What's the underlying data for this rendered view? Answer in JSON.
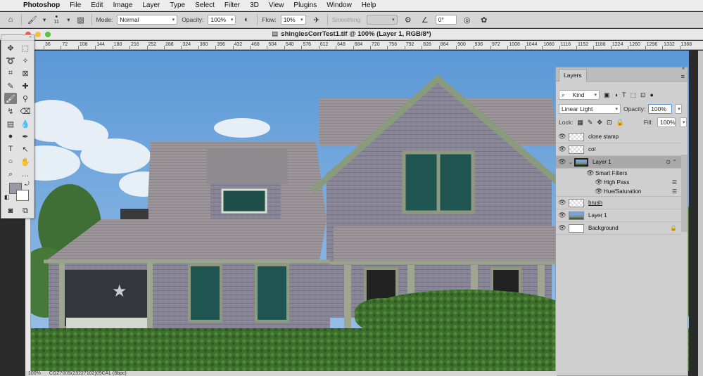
{
  "menubar": {
    "apple_icon": "apple-icon",
    "items": [
      "Photoshop",
      "File",
      "Edit",
      "Image",
      "Layer",
      "Type",
      "Select",
      "Filter",
      "3D",
      "View",
      "Plugins",
      "Window",
      "Help"
    ]
  },
  "options": {
    "brush_size": "11",
    "mode_label": "Mode:",
    "mode_value": "Normal",
    "opacity_label": "Opacity:",
    "opacity_value": "100%",
    "flow_label": "Flow:",
    "flow_value": "10%",
    "smoothing_label": "Smoothing:",
    "smoothing_value": "",
    "angle_value": "0°"
  },
  "document": {
    "title": "shinglesCorrTest1.tif @ 100% (Layer 1, RGB/8*)"
  },
  "ruler": {
    "ticks": [
      "36",
      "72",
      "108",
      "144",
      "180",
      "216",
      "252",
      "288",
      "324",
      "360",
      "396",
      "432",
      "468",
      "504",
      "540",
      "576",
      "612",
      "648",
      "684",
      "720",
      "756",
      "792",
      "828",
      "864",
      "900",
      "936",
      "972",
      "1008",
      "1044",
      "1080",
      "1116",
      "1152",
      "1188",
      "1224",
      "1260",
      "1296",
      "1332",
      "1368"
    ]
  },
  "layers_panel": {
    "tab_label": "Layers",
    "filter_kind": "Kind",
    "blend_mode": "Linear Light",
    "opacity_label": "Opacity:",
    "opacity_value": "100%",
    "lock_label": "Lock:",
    "fill_label": "Fill:",
    "fill_value": "100%",
    "layers": [
      {
        "name": "clone stamp"
      },
      {
        "name": "col"
      },
      {
        "name": "Layer 1"
      },
      {
        "name": "Smart Filters"
      },
      {
        "name": "High Pass"
      },
      {
        "name": "Hue/Saturation"
      },
      {
        "name": "brush"
      },
      {
        "name": "Layer 1"
      },
      {
        "name": "Background"
      }
    ]
  },
  "status": {
    "zoom": "100%",
    "profile": "CGZ700S(23227102)09CAL (8bpc)"
  },
  "colors": {
    "sky": "#6fa8dc",
    "shingle": "#8c8a9a",
    "trim": "#8e9a80",
    "hedge": "#3b6b2a"
  }
}
